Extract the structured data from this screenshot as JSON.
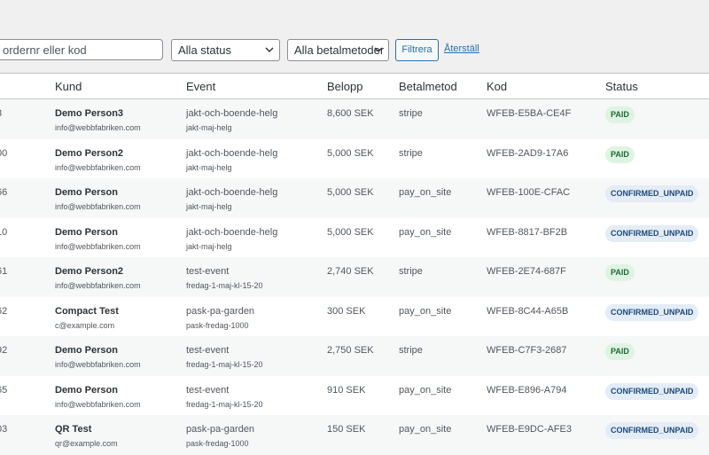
{
  "filters": {
    "search_placeholder": "ordernr eller kod",
    "status_select": "Alla status",
    "method_select": "Alla betalmetoder",
    "filter_button": "Filtrera",
    "reset_link": "Återställ"
  },
  "table": {
    "headers": {
      "customer": "Kund",
      "event": "Event",
      "amount": "Belopp",
      "method": "Betalmetod",
      "code": "Kod",
      "status": "Status"
    },
    "rows": [
      {
        "id": "3",
        "name": "Demo Person3",
        "email": "info@webbfabriken.com",
        "event": "jakt-och-boende-helg",
        "slug": "jakt-maj-helg",
        "amount": "8,600 SEK",
        "method": "stripe",
        "code": "WFEB-E5BA-CE4F",
        "status": "PAID"
      },
      {
        "id": "00",
        "name": "Demo Person2",
        "email": "info@webbfabriken.com",
        "event": "jakt-och-boende-helg",
        "slug": "jakt-maj-helg",
        "amount": "5,000 SEK",
        "method": "stripe",
        "code": "WFEB-2AD9-17A6",
        "status": "PAID"
      },
      {
        "id": "66",
        "name": "Demo Person",
        "email": "info@webbfabriken.com",
        "event": "jakt-och-boende-helg",
        "slug": "jakt-maj-helg",
        "amount": "5,000 SEK",
        "method": "pay_on_site",
        "code": "WFEB-100E-CFAC",
        "status": "CONFIRMED_UNPAID"
      },
      {
        "id": "10",
        "name": "Demo Person",
        "email": "info@webbfabriken.com",
        "event": "jakt-och-boende-helg",
        "slug": "jakt-maj-helg",
        "amount": "5,000 SEK",
        "method": "pay_on_site",
        "code": "WFEB-8817-BF2B",
        "status": "CONFIRMED_UNPAID"
      },
      {
        "id": "61",
        "name": "Demo Person2",
        "email": "info@webbfabriken.com",
        "event": "test-event",
        "slug": "fredag-1-maj-kl-15-20",
        "amount": "2,740 SEK",
        "method": "stripe",
        "code": "WFEB-2E74-687F",
        "status": "PAID"
      },
      {
        "id": "62",
        "name": "Compact Test",
        "email": "c@example.com",
        "event": "pask-pa-garden",
        "slug": "pask-fredag-1000",
        "amount": "300 SEK",
        "method": "pay_on_site",
        "code": "WFEB-8C44-A65B",
        "status": "CONFIRMED_UNPAID"
      },
      {
        "id": "92",
        "name": "Demo Person",
        "email": "info@webbfabriken.com",
        "event": "test-event",
        "slug": "fredag-1-maj-kl-15-20",
        "amount": "2,750 SEK",
        "method": "stripe",
        "code": "WFEB-C7F3-2687",
        "status": "PAID"
      },
      {
        "id": "65",
        "name": "Demo Person",
        "email": "info@webbfabriken.com",
        "event": "test-event",
        "slug": "fredag-1-maj-kl-15-20",
        "amount": "910 SEK",
        "method": "pay_on_site",
        "code": "WFEB-E896-A794",
        "status": "CONFIRMED_UNPAID"
      },
      {
        "id": "03",
        "name": "QR Test",
        "email": "qr@example.com",
        "event": "pask-pa-garden",
        "slug": "pask-fredag-1000",
        "amount": "150 SEK",
        "method": "pay_on_site",
        "code": "WFEB-E9DC-AFE3",
        "status": "CONFIRMED_UNPAID"
      }
    ]
  }
}
